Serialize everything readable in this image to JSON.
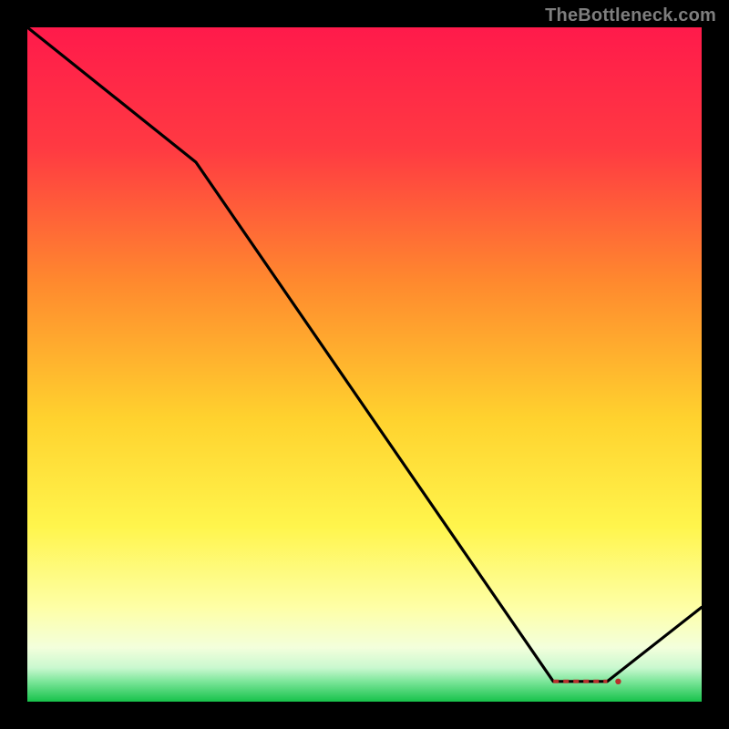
{
  "watermark": "TheBottleneck.com",
  "point_label": "",
  "colors": {
    "frame": "#000000",
    "line": "#000000",
    "gradient_top": "#ff1a4b",
    "gradient_mid1": "#ff6a2e",
    "gradient_mid2": "#ffd22e",
    "gradient_mid3": "#fff54c",
    "gradient_mid4": "#f6ffc3",
    "gradient_bottom_band": "#5fd97a",
    "gradient_bottom": "#17c24b",
    "label_color": "#b7312c"
  },
  "chart_data": {
    "type": "line",
    "title": "",
    "xlabel": "",
    "ylabel": "",
    "xlim": [
      0,
      100
    ],
    "ylim": [
      0,
      100
    ],
    "grid": false,
    "legend": false,
    "series": [
      {
        "name": "curve",
        "x": [
          0,
          25,
          78,
          86,
          100
        ],
        "values": [
          100,
          80,
          3,
          3,
          14
        ]
      }
    ],
    "annotations": [
      {
        "type": "dashed-segment",
        "x0": 78,
        "y0": 3,
        "x1": 86,
        "y1": 3
      }
    ]
  }
}
